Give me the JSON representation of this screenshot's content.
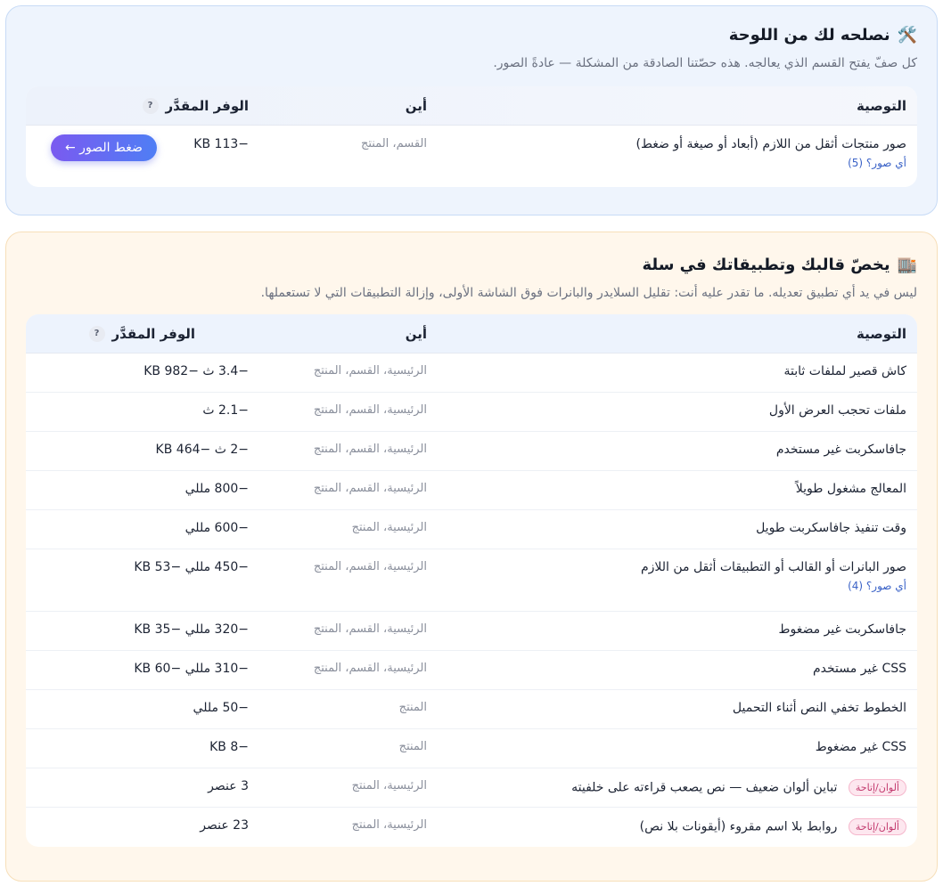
{
  "fix_panel": {
    "icon": "🛠️",
    "title": "نصلحه لك من اللوحة",
    "subtitle": "كل صفّ يفتح القسم الذي يعالجه. هذه حصّتنا الصادقة من المشكلة — عادةً الصور.",
    "headers": {
      "rec": "التوصية",
      "where": "أين",
      "saving": "الوفر المقدَّر",
      "q": "?"
    },
    "rows": [
      {
        "rec": "صور منتجات أثقل من اللازم (أبعاد أو صيغة أو ضغط)",
        "sub": "أي صور؟ (5)",
        "where": "القسم، المنتج",
        "saving": "−113 KB",
        "button": "ضغط الصور ←"
      }
    ]
  },
  "theme_panel": {
    "icon": "🏬",
    "title": "يخصّ قالبك وتطبيقاتك في سلة",
    "subtitle": "ليس في يد أي تطبيق تعديله. ما تقدر عليه أنت: تقليل السلايدر والبانرات فوق الشاشة الأولى، وإزالة التطبيقات التي لا تستعملها.",
    "headers": {
      "rec": "التوصية",
      "where": "أين",
      "saving": "الوفر المقدَّر",
      "q": "?"
    },
    "rows": [
      {
        "rec": "كاش قصير لملفات ثابتة",
        "where": "الرئيسية، القسم، المنتج",
        "saving": "−3.4 ث −982 KB"
      },
      {
        "rec": "ملفات تحجب العرض الأول",
        "where": "الرئيسية، القسم، المنتج",
        "saving": "−2.1 ث"
      },
      {
        "rec": "جافاسكربت غير مستخدم",
        "where": "الرئيسية، القسم، المنتج",
        "saving": "−2 ث −464 KB"
      },
      {
        "rec": "المعالج مشغول طويلاً",
        "where": "الرئيسية، القسم، المنتج",
        "saving": "−800 مللي"
      },
      {
        "rec": "وقت تنفيذ جافاسكربت طويل",
        "where": "الرئيسية، المنتج",
        "saving": "−600 مللي"
      },
      {
        "rec": "صور البانرات أو القالب أو التطبيقات أثقل من اللازم",
        "sub": "أي صور؟ (4)",
        "where": "الرئيسية، القسم، المنتج",
        "saving": "−450 مللي −53 KB"
      },
      {
        "rec": "جافاسكربت غير مضغوط",
        "where": "الرئيسية، القسم، المنتج",
        "saving": "−320 مللي −35 KB"
      },
      {
        "rec": "CSS غير مستخدم",
        "where": "الرئيسية، القسم، المنتج",
        "saving": "−310 مللي −60 KB"
      },
      {
        "rec": "الخطوط تخفي النص أثناء التحميل",
        "where": "المنتج",
        "saving": "−50 مللي"
      },
      {
        "rec": "CSS غير مضغوط",
        "where": "المنتج",
        "saving": "−8 KB"
      },
      {
        "rec": "تباين ألوان ضعيف — نص يصعب قراءته على خلفيته",
        "tag": "ألوان/إتاحة",
        "where": "الرئيسية، المنتج",
        "saving": "3 عنصر"
      },
      {
        "rec": "روابط بلا اسم مقروء (أيقونات بلا نص)",
        "tag": "ألوان/إتاحة",
        "where": "الرئيسية، المنتج",
        "saving": "23 عنصر"
      }
    ]
  }
}
